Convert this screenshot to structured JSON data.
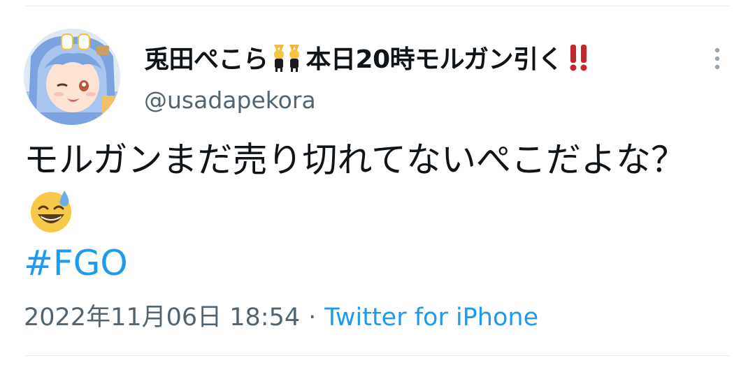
{
  "tweet": {
    "author": {
      "display_name_parts": [
        "兎田ぺこら",
        "本日20時モルガン引く"
      ],
      "handle": "@usadapekora",
      "avatar_icon": "avatar-image"
    },
    "name_emojis": [
      "people-with-bunny-ears-emoji",
      "double-exclamation-emoji"
    ],
    "text": "モルガンまだ売り切れてないぺこだよな？",
    "text_emoji": "grinning-face-with-sweat-emoji",
    "hashtag": "#FGO",
    "timestamp": "2022年11月06日 18:54",
    "separator": "·",
    "source": "Twitter for iPhone"
  },
  "colors": {
    "link": "#1d9bf0",
    "secondary_text": "#536471",
    "primary_text": "#0f1419",
    "divider": "#e6ecf0",
    "exclamation": "#c1272d"
  }
}
